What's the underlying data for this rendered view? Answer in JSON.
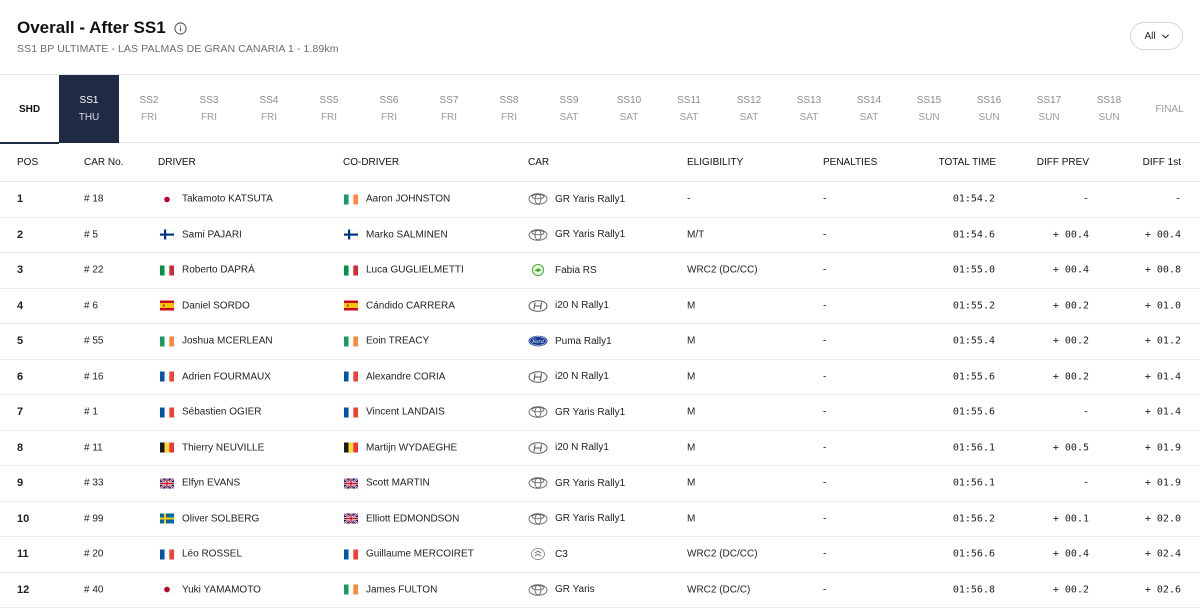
{
  "header": {
    "title": "Overall - After SS1",
    "subtitle": "SS1 BP ULTIMATE - LAS PALMAS DE GRAN CANARIA 1 - 1.89km",
    "filter_label": "All"
  },
  "stages": [
    {
      "label": "SHD",
      "day": ""
    },
    {
      "label": "SS1",
      "day": "THU"
    },
    {
      "label": "SS2",
      "day": "FRI"
    },
    {
      "label": "SS3",
      "day": "FRI"
    },
    {
      "label": "SS4",
      "day": "FRI"
    },
    {
      "label": "SS5",
      "day": "FRI"
    },
    {
      "label": "SS6",
      "day": "FRI"
    },
    {
      "label": "SS7",
      "day": "FRI"
    },
    {
      "label": "SS8",
      "day": "FRI"
    },
    {
      "label": "SS9",
      "day": "SAT"
    },
    {
      "label": "SS10",
      "day": "SAT"
    },
    {
      "label": "SS11",
      "day": "SAT"
    },
    {
      "label": "SS12",
      "day": "SAT"
    },
    {
      "label": "SS13",
      "day": "SAT"
    },
    {
      "label": "SS14",
      "day": "SAT"
    },
    {
      "label": "SS15",
      "day": "SUN"
    },
    {
      "label": "SS16",
      "day": "SUN"
    },
    {
      "label": "SS17",
      "day": "SUN"
    },
    {
      "label": "SS18",
      "day": "SUN"
    },
    {
      "label": "FINAL",
      "day": ""
    }
  ],
  "active_stage": "SS1",
  "table": {
    "columns": {
      "pos": "POS",
      "car_no": "CAR No.",
      "driver": "DRIVER",
      "codriver": "CO-DRIVER",
      "car": "CAR",
      "eligibility": "ELIGIBILITY",
      "penalties": "PENALTIES",
      "total_time": "TOTAL TIME",
      "diff_prev": "DIFF PREV",
      "diff_first": "DIFF 1st"
    },
    "rows": [
      {
        "pos": "1",
        "car_no": "# 18",
        "driver": "Takamoto KATSUTA",
        "driver_flag": "japan-flag-icon",
        "codriver": "Aaron JOHNSTON",
        "codriver_flag": "ireland-flag-icon",
        "car": "GR Yaris Rally1",
        "car_logo": "toyota-logo-icon",
        "eligibility": "-",
        "penalties": "-",
        "total_time": "01:54.2",
        "diff_prev": "-",
        "diff_first": "-"
      },
      {
        "pos": "2",
        "car_no": "# 5",
        "driver": "Sami PAJARI",
        "driver_flag": "finland-flag-icon",
        "codriver": "Marko SALMINEN",
        "codriver_flag": "finland-flag-icon",
        "car": "GR Yaris Rally1",
        "car_logo": "toyota-logo-icon",
        "eligibility": "M/T",
        "penalties": "-",
        "total_time": "01:54.6",
        "diff_prev": "+ 00.4",
        "diff_first": "+ 00.4"
      },
      {
        "pos": "3",
        "car_no": "# 22",
        "driver": "Roberto DAPRÀ",
        "driver_flag": "italy-flag-icon",
        "codriver": "Luca GUGLIELMETTI",
        "codriver_flag": "italy-flag-icon",
        "car": "Fabia RS",
        "car_logo": "skoda-logo-icon",
        "eligibility": "WRC2 (DC/CC)",
        "penalties": "-",
        "total_time": "01:55.0",
        "diff_prev": "+ 00.4",
        "diff_first": "+ 00.8"
      },
      {
        "pos": "4",
        "car_no": "# 6",
        "driver": "Daniel SORDO",
        "driver_flag": "spain-flag-icon",
        "codriver": "Cándido CARRERA",
        "codriver_flag": "spain-flag-icon",
        "car": "i20 N Rally1",
        "car_logo": "hyundai-logo-icon",
        "eligibility": "M",
        "penalties": "-",
        "total_time": "01:55.2",
        "diff_prev": "+ 00.2",
        "diff_first": "+ 01.0"
      },
      {
        "pos": "5",
        "car_no": "# 55",
        "driver": "Joshua MCERLEAN",
        "driver_flag": "ireland-flag-icon",
        "codriver": "Eoin TREACY",
        "codriver_flag": "ireland-flag-icon",
        "car": "Puma Rally1",
        "car_logo": "ford-logo-icon",
        "eligibility": "M",
        "penalties": "-",
        "total_time": "01:55.4",
        "diff_prev": "+ 00.2",
        "diff_first": "+ 01.2"
      },
      {
        "pos": "6",
        "car_no": "# 16",
        "driver": "Adrien FOURMAUX",
        "driver_flag": "france-flag-icon",
        "codriver": "Alexandre CORIA",
        "codriver_flag": "france-flag-icon",
        "car": "i20 N Rally1",
        "car_logo": "hyundai-logo-icon",
        "eligibility": "M",
        "penalties": "-",
        "total_time": "01:55.6",
        "diff_prev": "+ 00.2",
        "diff_first": "+ 01.4"
      },
      {
        "pos": "7",
        "car_no": "# 1",
        "driver": "Sébastien OGIER",
        "driver_flag": "france-flag-icon",
        "codriver": "Vincent LANDAIS",
        "codriver_flag": "france-flag-icon",
        "car": "GR Yaris Rally1",
        "car_logo": "toyota-logo-icon",
        "eligibility": "M",
        "penalties": "-",
        "total_time": "01:55.6",
        "diff_prev": "-",
        "diff_first": "+ 01.4"
      },
      {
        "pos": "8",
        "car_no": "# 11",
        "driver": "Thierry NEUVILLE",
        "driver_flag": "belgium-flag-icon",
        "codriver": "Martijn WYDAEGHE",
        "codriver_flag": "belgium-flag-icon",
        "car": "i20 N Rally1",
        "car_logo": "hyundai-logo-icon",
        "eligibility": "M",
        "penalties": "-",
        "total_time": "01:56.1",
        "diff_prev": "+ 00.5",
        "diff_first": "+ 01.9"
      },
      {
        "pos": "9",
        "car_no": "# 33",
        "driver": "Elfyn EVANS",
        "driver_flag": "uk-flag-icon",
        "codriver": "Scott MARTIN",
        "codriver_flag": "uk-flag-icon",
        "car": "GR Yaris Rally1",
        "car_logo": "toyota-logo-icon",
        "eligibility": "M",
        "penalties": "-",
        "total_time": "01:56.1",
        "diff_prev": "-",
        "diff_first": "+ 01.9"
      },
      {
        "pos": "10",
        "car_no": "# 99",
        "driver": "Oliver SOLBERG",
        "driver_flag": "sweden-flag-icon",
        "codriver": "Elliott EDMONDSON",
        "codriver_flag": "uk-flag-icon",
        "car": "GR Yaris Rally1",
        "car_logo": "toyota-logo-icon",
        "eligibility": "M",
        "penalties": "-",
        "total_time": "01:56.2",
        "diff_prev": "+ 00.1",
        "diff_first": "+ 02.0"
      },
      {
        "pos": "11",
        "car_no": "# 20",
        "driver": "Léo ROSSEL",
        "driver_flag": "france-flag-icon",
        "codriver": "Guillaume MERCOIRET",
        "codriver_flag": "france-flag-icon",
        "car": "C3",
        "car_logo": "citroen-logo-icon",
        "eligibility": "WRC2 (DC/CC)",
        "penalties": "-",
        "total_time": "01:56.6",
        "diff_prev": "+ 00.4",
        "diff_first": "+ 02.4"
      },
      {
        "pos": "12",
        "car_no": "# 40",
        "driver": "Yuki YAMAMOTO",
        "driver_flag": "japan-flag-icon",
        "codriver": "James FULTON",
        "codriver_flag": "ireland-flag-icon",
        "car": "GR Yaris",
        "car_logo": "toyota-logo-icon",
        "eligibility": "WRC2 (DC/C)",
        "penalties": "-",
        "total_time": "01:56.8",
        "diff_prev": "+ 00.2",
        "diff_first": "+ 02.6"
      }
    ]
  },
  "colors": {
    "active_stage_bg": "#1f2a44",
    "divider": "#e6e6e6"
  }
}
